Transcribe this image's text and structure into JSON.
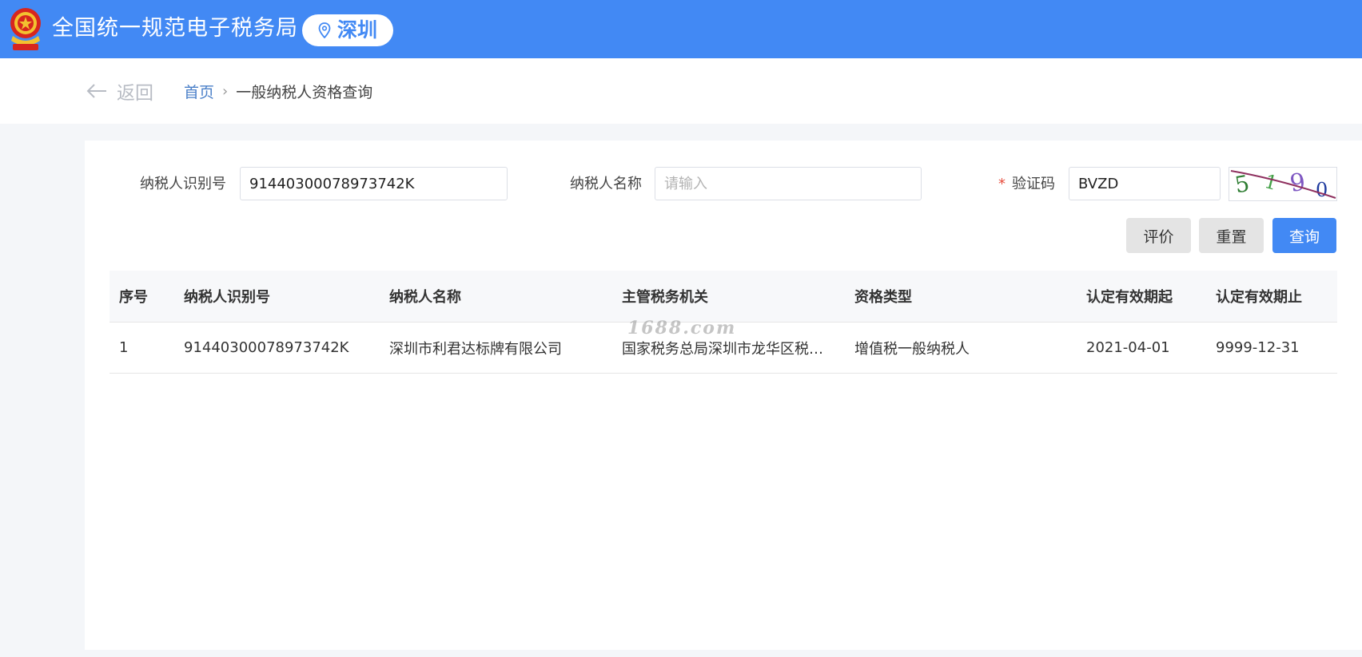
{
  "header": {
    "site_title": "全国统一规范电子税务局",
    "city": "深圳",
    "emblem_icon": "tax-emblem-icon",
    "brand_color": "#4289f4"
  },
  "nav": {
    "back_label": "返回",
    "breadcrumb": {
      "home": "首页",
      "separator": "›",
      "current": "一般纳税人资格查询"
    }
  },
  "form": {
    "taxpayer_id_label": "纳税人识别号",
    "taxpayer_id_value": "91440300078973742K",
    "taxpayer_name_label": "纳税人名称",
    "taxpayer_name_placeholder": "请输入",
    "captcha_required_mark": "*",
    "captcha_label": "验证码",
    "captcha_value": "BVZD",
    "captcha_image_text": "5190"
  },
  "buttons": {
    "rate": "评价",
    "reset": "重置",
    "query": "查询"
  },
  "table": {
    "columns": [
      "序号",
      "纳税人识别号",
      "纳税人名称",
      "主管税务机关",
      "资格类型",
      "认定有效期起",
      "认定有效期止"
    ],
    "rows": [
      [
        "1",
        "91440300078973742K",
        "深圳市利君达标牌有限公司",
        "国家税务总局深圳市龙华区税…",
        "增值税一般纳税人",
        "2021-04-01",
        "9999-12-31"
      ]
    ]
  },
  "watermark": "1688.com"
}
